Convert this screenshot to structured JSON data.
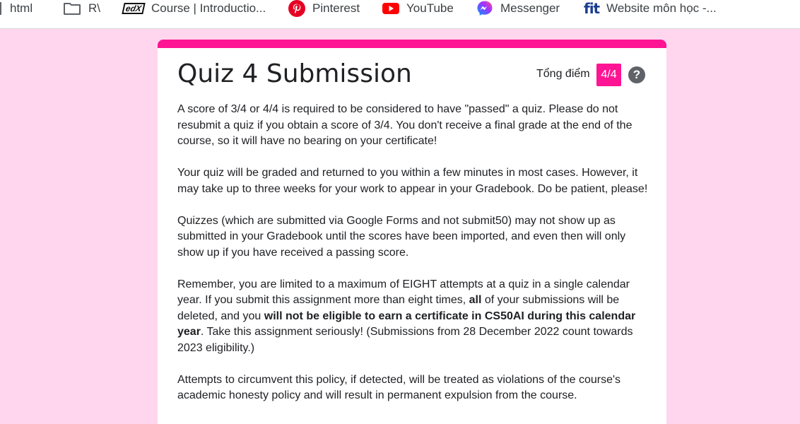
{
  "bookmarks": [
    {
      "label": "html",
      "icon": "page-icon"
    },
    {
      "label": "R\\",
      "icon": "folder-icon"
    },
    {
      "label": "Course | Introductio...",
      "icon": "edx-icon",
      "icon_text": "edX"
    },
    {
      "label": "Pinterest",
      "icon": "pinterest-icon"
    },
    {
      "label": "YouTube",
      "icon": "youtube-icon"
    },
    {
      "label": "Messenger",
      "icon": "messenger-icon"
    },
    {
      "label": "Website môn học -...",
      "icon": "fit-icon",
      "icon_text": "fit"
    }
  ],
  "form": {
    "title": "Quiz 4 Submission",
    "score_label": "Tổng điểm",
    "score_value": "4/4",
    "help_symbol": "?",
    "accent_color": "#ff1493",
    "paragraphs": {
      "p1": "A score of 3/4 or 4/4 is required to be considered to have \"passed\" a quiz. Please do not resubmit a quiz if you obtain a score of 3/4. You don't receive a final grade at the end of the course, so it will have no bearing on your certificate!",
      "p2": "Your quiz will be graded and returned to you within a few minutes in most cases. However, it may take up to three weeks for your work to appear in your Gradebook. Do be patient, please!",
      "p3": "Quizzes (which are submitted via Google Forms and not submit50) may not show up as submitted in your Gradebook until the scores have been imported, and even then will only show up if you have received a passing score.",
      "p4": {
        "t1": "Remember, you are limited to a maximum of EIGHT attempts at a quiz in a single calendar year. If you submit this assignment more than eight times, ",
        "b1": "all",
        "t2": " of your submissions will be deleted, and you ",
        "b2": "will not be eligible to earn a certificate in CS50AI during this calendar year",
        "t3": ". Take this assignment seriously! (Submissions from 28 December 2022 count towards 2023 eligibility.)"
      },
      "p5": "Attempts to circumvent this policy, if detected, will be treated as violations of the course's academic honesty policy and will result in permanent expulsion from the course."
    }
  }
}
